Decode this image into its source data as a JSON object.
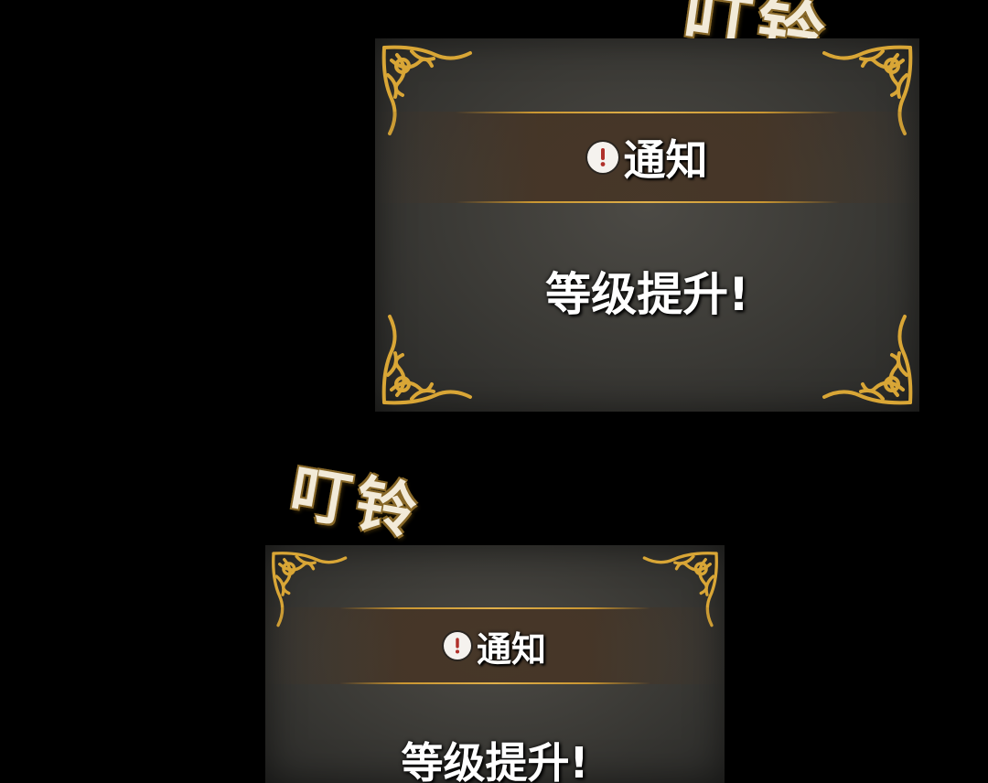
{
  "sound_effects": {
    "top": "叮铃",
    "bottom": "叮铃"
  },
  "dialogs": [
    {
      "title": "通知",
      "message": "等级提升!",
      "icon": "exclamation-circle-icon"
    },
    {
      "title": "通知",
      "message": "等级提升!",
      "icon": "exclamation-circle-icon"
    }
  ],
  "colors": {
    "background": "#000000",
    "panel": "#3a3935",
    "gold": "#c99632",
    "text": "#ffffff",
    "icon_mark": "#b0302a"
  }
}
